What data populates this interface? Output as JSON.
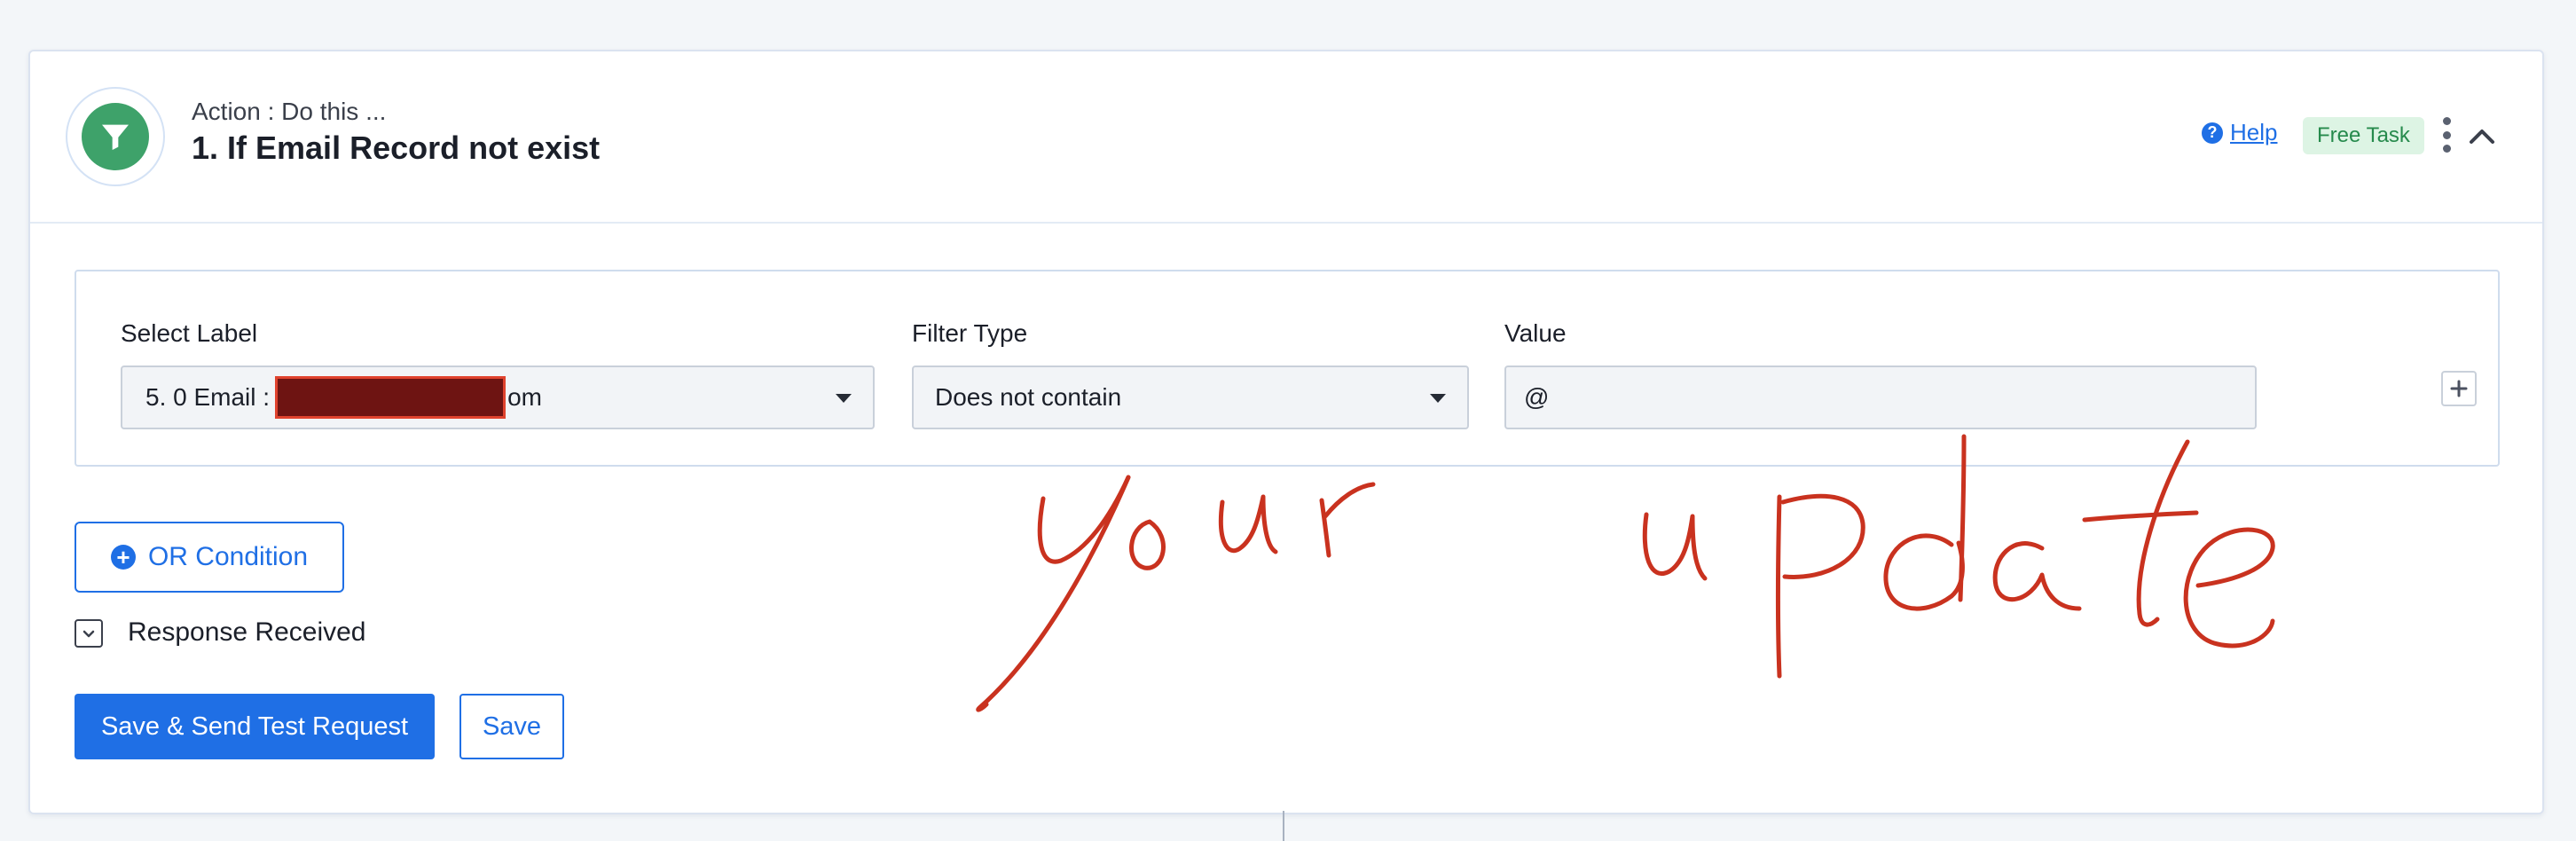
{
  "header": {
    "subtitle": "Action : Do this ...",
    "title": "1. If Email Record not exist",
    "help_label": "Help",
    "help_icon": "question-circle-icon",
    "badge_label": "Free Task",
    "step_icon": "filter-icon"
  },
  "filter": {
    "label_field": {
      "label": "Select Label",
      "value_prefix": "5. 0 Email :",
      "value_suffix": "om"
    },
    "type_field": {
      "label": "Filter Type",
      "value": "Does not contain"
    },
    "value_field": {
      "label": "Value",
      "value": "@"
    }
  },
  "actions": {
    "or_condition_label": "OR Condition",
    "response_label": "Response Received",
    "save_send_label": "Save & Send Test Request",
    "save_label": "Save"
  },
  "annotation": {
    "words": [
      "your",
      "update"
    ],
    "color": "#c9321f"
  },
  "colors": {
    "accent": "#1f6fe5",
    "step_icon_bg": "#3ea26a",
    "badge_bg": "#ddf4e4",
    "badge_text": "#268a4c"
  }
}
